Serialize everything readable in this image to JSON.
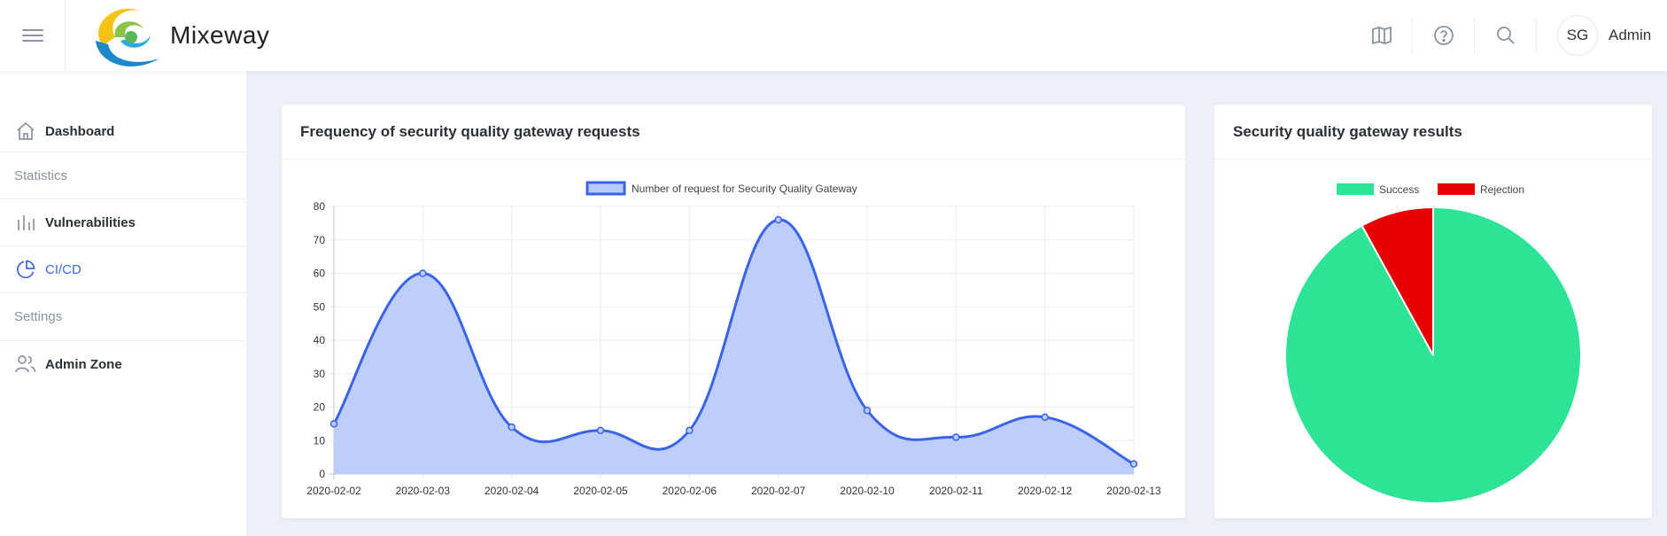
{
  "app": {
    "name": "Mixeway",
    "user_initials": "SG",
    "user_name": "Admin"
  },
  "topbar": {
    "icons": [
      "menu-icon",
      "book-icon",
      "help-icon",
      "search-icon"
    ]
  },
  "sidebar": {
    "items": [
      {
        "type": "link",
        "label": "Dashboard",
        "icon": "home-icon"
      },
      {
        "type": "section",
        "label": "Statistics"
      },
      {
        "type": "link",
        "label": "Vulnerabilities",
        "icon": "bar-chart-icon"
      },
      {
        "type": "link",
        "label": "CI/CD",
        "icon": "pie-chart-icon",
        "active": true
      },
      {
        "type": "section",
        "label": "Settings"
      },
      {
        "type": "link",
        "label": "Admin Zone",
        "icon": "users-icon"
      }
    ]
  },
  "colors": {
    "accent": "#3f6ad8",
    "line": "#3b63e8",
    "area": "#b9cbfb",
    "success": "#2de396",
    "rejection": "#e60000"
  },
  "cards": {
    "requests_title": "Frequency of security quality gateway requests",
    "results_title": "Security quality gateway results"
  },
  "chart_data": [
    {
      "type": "area",
      "title": "",
      "series": [
        {
          "name": "Number of request for Security Quality Gateway",
          "values": [
            15,
            60,
            14,
            13,
            13,
            76,
            19,
            11,
            17,
            3
          ]
        }
      ],
      "categories": [
        "2020-02-02",
        "2020-02-03",
        "2020-02-04",
        "2020-02-05",
        "2020-02-06",
        "2020-02-07",
        "2020-02-10",
        "2020-02-11",
        "2020-02-12",
        "2020-02-13"
      ],
      "yticks": [
        "0",
        "10",
        "20",
        "30",
        "40",
        "50",
        "60",
        "70",
        "80"
      ],
      "ylim": [
        0,
        80
      ],
      "grid": true,
      "legend": "top-center"
    },
    {
      "type": "pie",
      "title": "",
      "labels": [
        "Success",
        "Rejection"
      ],
      "values": [
        92,
        8
      ],
      "legend": "top-center"
    }
  ]
}
